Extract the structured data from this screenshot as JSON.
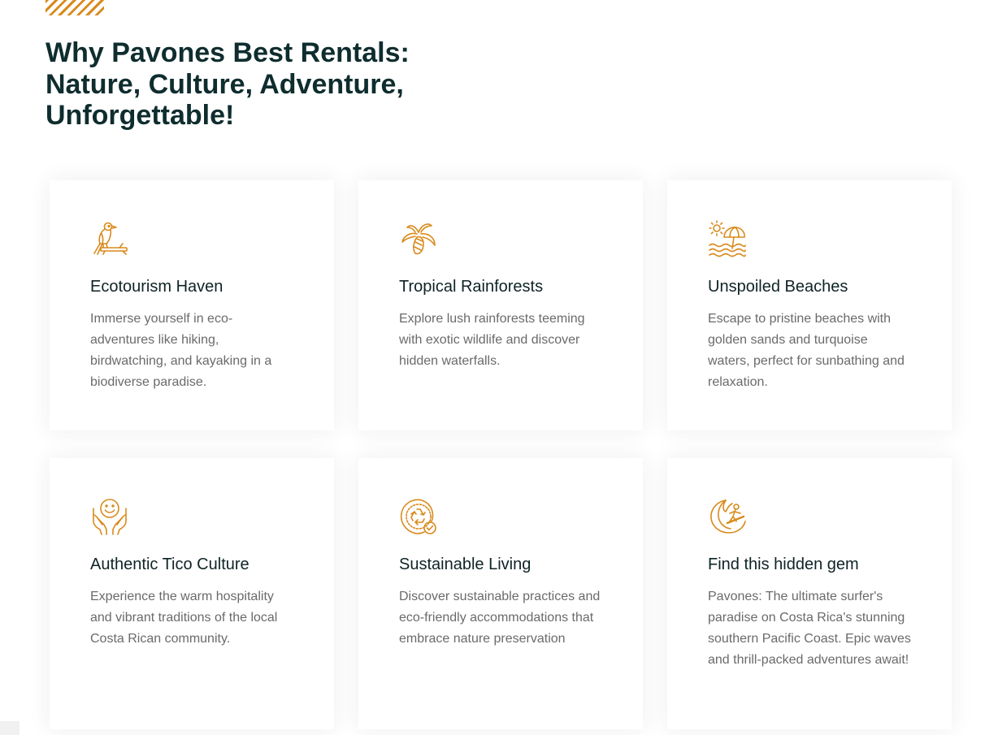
{
  "section": {
    "heading_line1": "Why Pavones Best Rentals:",
    "heading_line2": "Nature, Culture, Adventure,",
    "heading_line3": "Unforgettable!"
  },
  "colors": {
    "accent": "#d98a1c",
    "heading": "#0f2d2e",
    "body_text": "#6a6a6a"
  },
  "features": [
    {
      "icon": "bird-on-branch-icon",
      "title": "Ecotourism Haven",
      "text": "Immerse yourself in eco-adventures like hiking, birdwatching, and kayaking in a biodiverse paradise."
    },
    {
      "icon": "coconut-palm-icon",
      "title": "Tropical Rainforests",
      "text": "Explore lush rainforests teeming with exotic wildlife and discover hidden waterfalls."
    },
    {
      "icon": "beach-umbrella-sun-icon",
      "title": "Unspoiled Beaches",
      "text": "Escape to pristine beaches with golden sands and turquoise waters, perfect for sunbathing and relaxation."
    },
    {
      "icon": "smiley-hands-icon",
      "title": "Authentic Tico Culture",
      "text": "Experience the warm hospitality and vibrant traditions of the local Costa Rican community."
    },
    {
      "icon": "recycle-check-icon",
      "title": "Sustainable Living",
      "text": "Discover sustainable practices and eco-friendly accommodations that embrace nature preservation"
    },
    {
      "icon": "surfer-wave-icon",
      "title": "Find this hidden gem",
      "text": "Pavones: The ultimate surfer's paradise on Costa Rica's stunning southern Pacific Coast. Epic waves and thrill-packed adventures await!"
    }
  ]
}
